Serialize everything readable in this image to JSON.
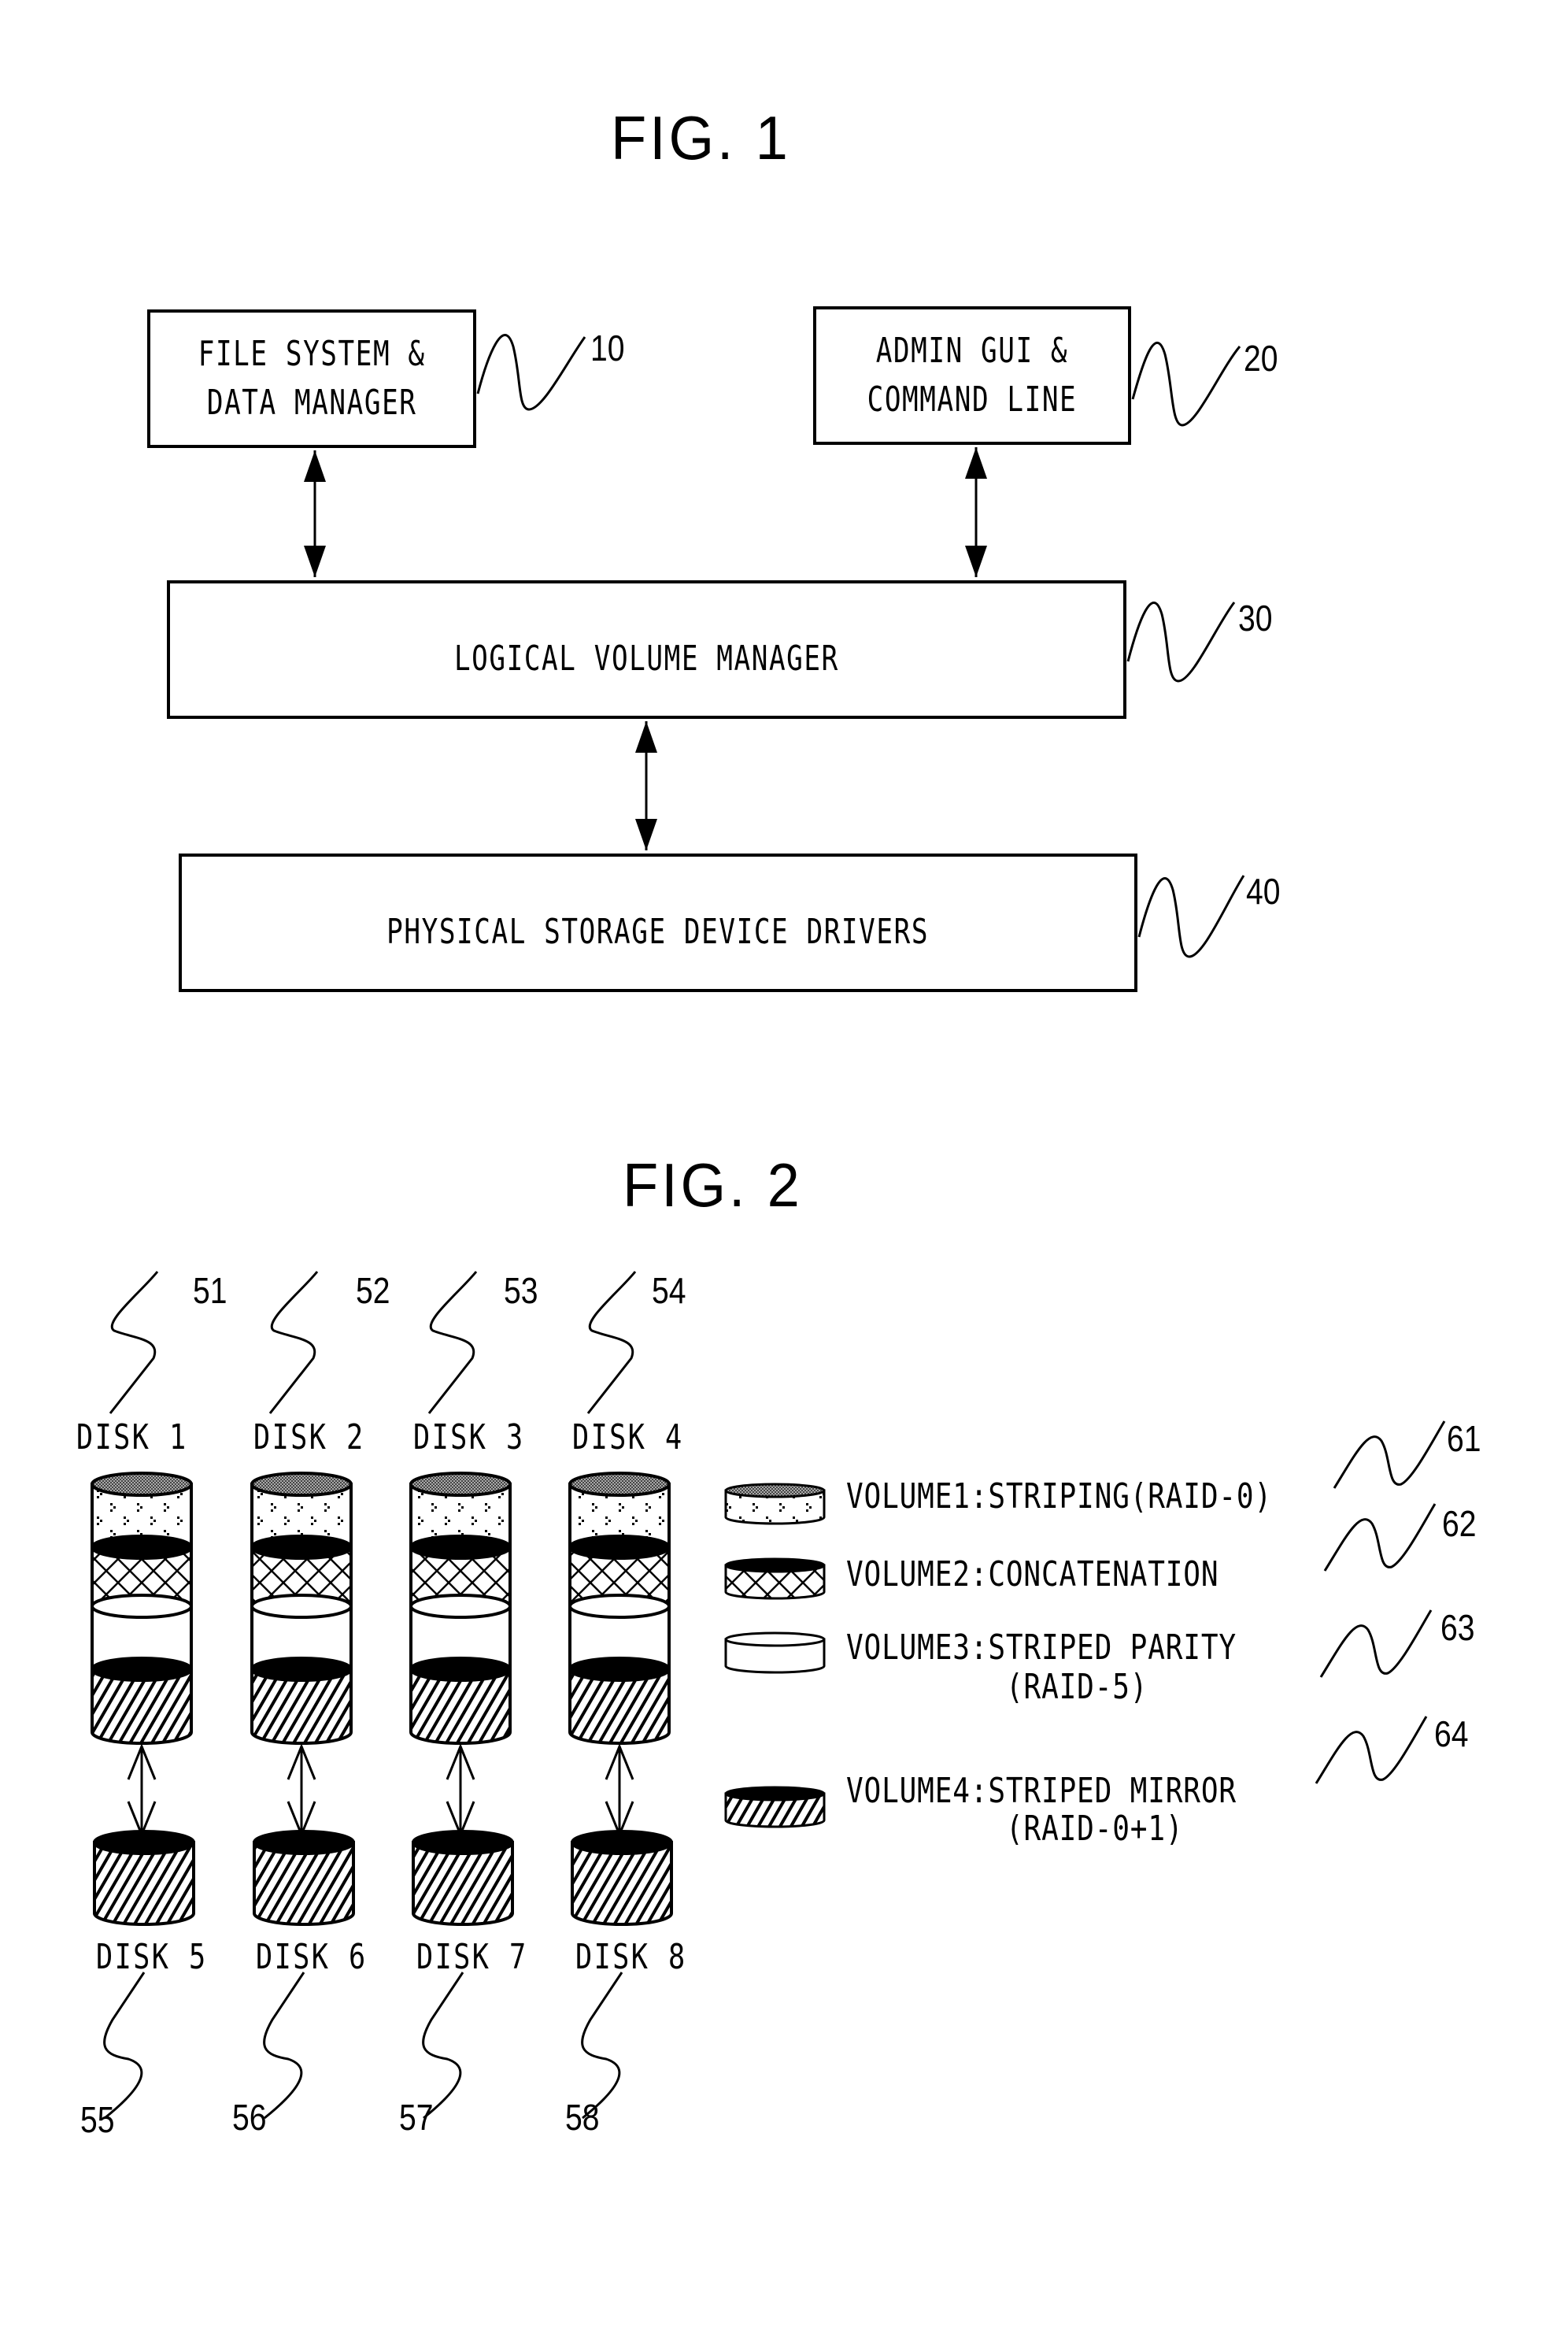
{
  "fig1": {
    "title": "FIG. 1",
    "blocks": [
      {
        "id": "10",
        "label": "FILE SYSTEM &\nDATA MANAGER"
      },
      {
        "id": "20",
        "label": "ADMIN GUI &\nCOMMAND LINE"
      },
      {
        "id": "30",
        "label": "LOGICAL VOLUME MANAGER"
      },
      {
        "id": "40",
        "label": "PHYSICAL STORAGE DEVICE DRIVERS"
      }
    ],
    "connections": [
      {
        "from": "10",
        "to": "30",
        "type": "bidirectional"
      },
      {
        "from": "20",
        "to": "30",
        "type": "bidirectional"
      },
      {
        "from": "30",
        "to": "40",
        "type": "bidirectional"
      }
    ]
  },
  "fig2": {
    "title": "FIG. 2",
    "primary_disks": [
      {
        "label": "DISK 1",
        "ref": "51"
      },
      {
        "label": "DISK 2",
        "ref": "52"
      },
      {
        "label": "DISK 3",
        "ref": "53"
      },
      {
        "label": "DISK 4",
        "ref": "54"
      }
    ],
    "mirror_disks": [
      {
        "label": "DISK 5",
        "ref": "55"
      },
      {
        "label": "DISK 6",
        "ref": "56"
      },
      {
        "label": "DISK 7",
        "ref": "57"
      },
      {
        "label": "DISK 8",
        "ref": "58"
      }
    ],
    "disk_segments": [
      "volume1",
      "volume2",
      "volume3",
      "volume4"
    ],
    "legend": [
      {
        "key": "volume1",
        "pattern": "dots",
        "line1": "VOLUME1:STRIPING(RAID-0)",
        "line2": "",
        "ref": "61"
      },
      {
        "key": "volume2",
        "pattern": "crosshatch",
        "line1": "VOLUME2:CONCATENATION",
        "line2": "",
        "ref": "62"
      },
      {
        "key": "volume3",
        "pattern": "blank",
        "line1": "VOLUME3:STRIPED PARITY",
        "line2": "(RAID-5)",
        "ref": "63"
      },
      {
        "key": "volume4",
        "pattern": "diagonal",
        "line1": "VOLUME4:STRIPED MIRROR",
        "line2": "(RAID-0+1)",
        "ref": "64"
      }
    ]
  }
}
